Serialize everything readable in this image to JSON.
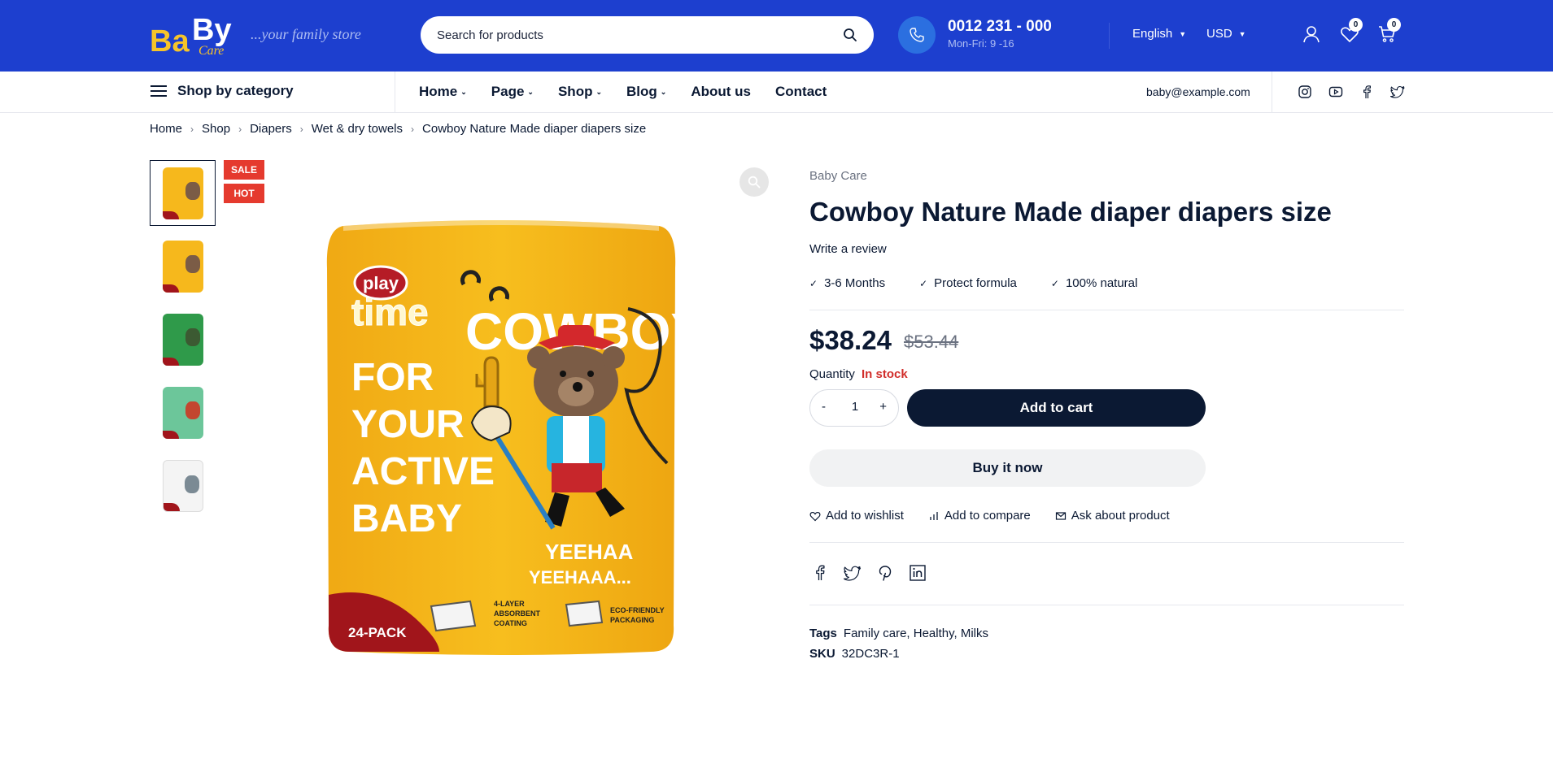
{
  "header": {
    "logo": {
      "part1": "Ba",
      "part2": "By",
      "part3": "Care"
    },
    "tagline": "...your family store",
    "search_placeholder": "Search for products",
    "phone_number": "0012 231 - 000",
    "phone_hours": "Mon-Fri: 9 -16",
    "language": "English",
    "currency": "USD",
    "wishlist_count": "0",
    "cart_count": "0",
    "icons": [
      "search-icon",
      "phone-icon",
      "user-icon",
      "heart-icon",
      "cart-icon"
    ]
  },
  "nav": {
    "category_label": "Shop by category",
    "items": [
      {
        "label": "Home",
        "dropdown": true
      },
      {
        "label": "Page",
        "dropdown": true
      },
      {
        "label": "Shop",
        "dropdown": true
      },
      {
        "label": "Blog",
        "dropdown": true
      },
      {
        "label": "About us",
        "dropdown": false
      },
      {
        "label": "Contact",
        "dropdown": false
      }
    ],
    "email": "baby@example.com",
    "social": [
      "instagram-icon",
      "youtube-icon",
      "facebook-icon",
      "twitter-icon"
    ]
  },
  "breadcrumb": [
    "Home",
    "Shop",
    "Diapers",
    "Wet & dry towels",
    "Cowboy Nature Made diaper diapers size"
  ],
  "gallery": {
    "badges": [
      "SALE",
      "HOT"
    ],
    "thumb_colors": [
      "#f6b81c",
      "#f6b81c",
      "#2f9a4a",
      "#6cc69a",
      "#f4f4f4"
    ],
    "pack": {
      "brand_line1": "play",
      "brand_line2": "time",
      "headline": "COWBOY",
      "lines": [
        "FOR",
        "YOUR",
        "ACTIVE",
        "BABY"
      ],
      "shout1": "YEEHAA",
      "shout2": "YEEHAAA...",
      "pack_size": "24-PACK",
      "feature1": [
        "4-LAYER",
        "ABSORBENT",
        "COATING"
      ],
      "feature2": [
        "ECO-FRIENDLY",
        "PACKAGING"
      ]
    }
  },
  "product": {
    "brand": "Baby Care",
    "title": "Cowboy Nature Made diaper diapers size",
    "review_link": "Write a review",
    "features": [
      "3-6 Months",
      "Protect formula",
      "100% natural"
    ],
    "price": "$38.24",
    "old_price": "$53.44",
    "quantity_label": "Quantity",
    "stock_status": "In stock",
    "quantity": "1",
    "minus": "-",
    "plus": "+",
    "add_to_cart": "Add to cart",
    "buy_now": "Buy it now",
    "actions": [
      "Add to wishlist",
      "Add to compare",
      "Ask about product"
    ],
    "share_icons": [
      "facebook-icon",
      "twitter-icon",
      "pinterest-icon",
      "linkedin-icon"
    ],
    "tags_label": "Tags",
    "tags": "Family care, Healthy, Milks",
    "sku_label": "SKU",
    "sku": "32DC3R-1"
  },
  "colors": {
    "header_bg": "#1d3fcf",
    "logo_yellow": "#f6c42a",
    "dark_button": "#0b1933",
    "badge_red": "#e53a2e",
    "stock_red": "#d12d2a"
  }
}
